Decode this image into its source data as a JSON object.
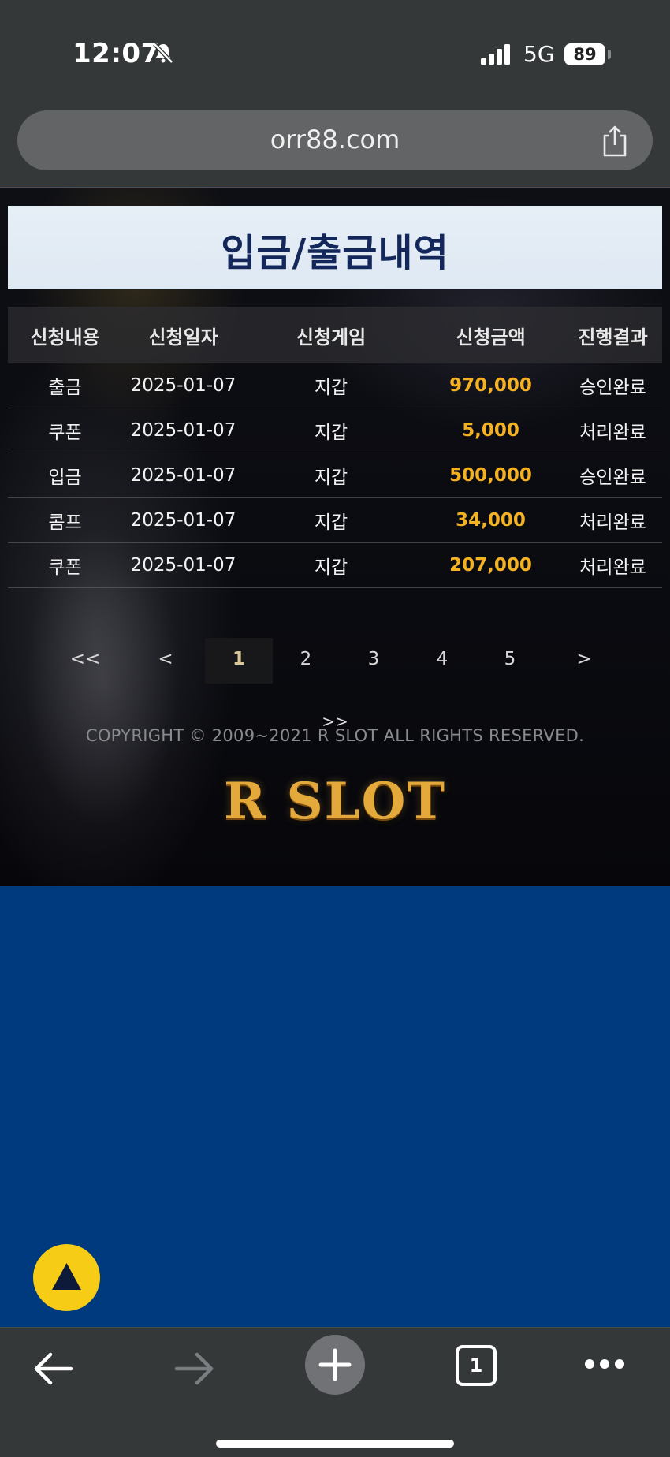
{
  "status_bar": {
    "time": "12:07",
    "network": "5G",
    "battery": "89"
  },
  "browser": {
    "url": "orr88.com"
  },
  "page": {
    "title": "입금/출금내역",
    "table": {
      "headers": [
        "신청내용",
        "신청일자",
        "신청게임",
        "신청금액",
        "진행결과"
      ],
      "rows": [
        {
          "type": "출금",
          "date": "2025-01-07",
          "game": "지갑",
          "amount": "970,000",
          "result": "승인완료"
        },
        {
          "type": "쿠폰",
          "date": "2025-01-07",
          "game": "지갑",
          "amount": "5,000",
          "result": "처리완료"
        },
        {
          "type": "입금",
          "date": "2025-01-07",
          "game": "지갑",
          "amount": "500,000",
          "result": "승인완료"
        },
        {
          "type": "콤프",
          "date": "2025-01-07",
          "game": "지갑",
          "amount": "34,000",
          "result": "처리완료"
        },
        {
          "type": "쿠폰",
          "date": "2025-01-07",
          "game": "지갑",
          "amount": "207,000",
          "result": "처리완료"
        }
      ]
    },
    "pagination": {
      "first": "<<",
      "prev": "<",
      "pages": [
        "1",
        "2",
        "3",
        "4",
        "5"
      ],
      "current": "1",
      "next": ">",
      "last": ">>"
    },
    "copyright": "COPYRIGHT © 2009~2021 R SLOT ALL RIGHTS RESERVED.",
    "logo": "R SLOT"
  },
  "colors": {
    "title_text": "#14275a",
    "amount": "#f4b223",
    "scroll_button": "#f6cc16",
    "page_background": "#003a7e"
  },
  "toolbar": {
    "tab_count": "1"
  },
  "icons": [
    "bell-slash-icon",
    "signal-icon",
    "share-icon",
    "arrow-up-icon",
    "back-arrow-icon",
    "forward-arrow-icon",
    "plus-icon",
    "tabs-icon",
    "more-icon"
  ]
}
